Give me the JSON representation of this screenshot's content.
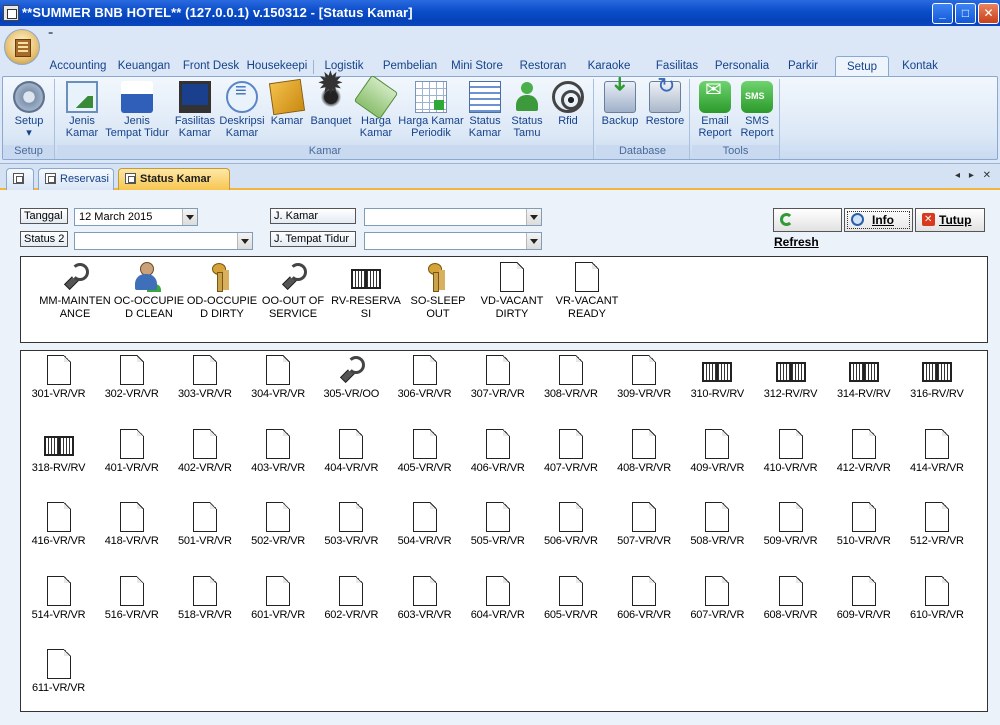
{
  "window": {
    "title": "**SUMMER BNB HOTEL** (127.0.0.1) v.150312 - [Status Kamar]",
    "controls": {
      "minimize": "_",
      "maximize": "□",
      "close": "✕"
    }
  },
  "qat": {
    "dropdown": "⁼"
  },
  "ribbon": {
    "tabs": [
      "Accounting",
      "Keuangan",
      "Front Desk",
      "Housekeepi",
      "Logistik",
      "Pembelian",
      "Mini Store",
      "Restoran",
      "Karaoke",
      "Fasilitas",
      "Personalia",
      "Parkir",
      "Setup",
      "Kontak"
    ],
    "active_tab": "Setup",
    "groups": {
      "setup": {
        "label": "Setup",
        "buttons": {
          "setup": "Setup",
          "setup_arrow": "▾"
        }
      },
      "kamar": {
        "label": "Kamar",
        "buttons": {
          "jenis_kamar": [
            "Jenis",
            "Kamar"
          ],
          "jenis_tempat_tidur": [
            "Jenis",
            "Tempat Tidur"
          ],
          "fasilitas_kamar": [
            "Fasilitas",
            "Kamar"
          ],
          "deskripsi_kamar": [
            "Deskripsi",
            "Kamar"
          ],
          "kamar": [
            "Kamar",
            ""
          ],
          "banquet": [
            "Banquet",
            ""
          ],
          "harga_kamar": [
            "Harga",
            "Kamar"
          ],
          "harga_kamar_periodik": [
            "Harga Kamar",
            "Periodik"
          ],
          "status_kamar": [
            "Status",
            "Kamar"
          ],
          "status_tamu": [
            "Status",
            "Tamu"
          ],
          "rfid": [
            "Rfid",
            ""
          ]
        }
      },
      "database": {
        "label": "Database",
        "buttons": {
          "backup": "Backup",
          "restore": "Restore"
        }
      },
      "tools": {
        "label": "Tools",
        "buttons": {
          "email_report": [
            "Email",
            "Report"
          ],
          "sms_report": [
            "SMS",
            "Report"
          ]
        }
      }
    }
  },
  "doc_tabs": {
    "items": [
      "",
      "Reservasi",
      "Status Kamar"
    ],
    "active": "Status Kamar",
    "nav": "◂ ▸ ✕"
  },
  "filters": {
    "tanggal_label": "Tanggal",
    "tanggal_value": "12   March    2015",
    "status2_label": "Status 2",
    "status2_value": "",
    "jkamar_label": "J. Kamar",
    "jkamar_value": "",
    "jtempat_label": "J. Tempat Tidur",
    "jtempat_value": ""
  },
  "actions": {
    "refresh": "Refresh",
    "info": "Info",
    "tutup": "Tutup"
  },
  "legend": [
    {
      "icon": "wrench-icon",
      "line1": "MM-MAINTEN",
      "line2": "ANCE"
    },
    {
      "icon": "person-icon",
      "line1": "OC-OCCUPIE",
      "line2": "D CLEAN"
    },
    {
      "icon": "keys-icon",
      "line1": "OD-OCCUPIE",
      "line2": "D DIRTY"
    },
    {
      "icon": "wrench-icon",
      "line1": "OO-OUT OF",
      "line2": "SERVICE"
    },
    {
      "icon": "book-icon",
      "line1": "RV-RESERVA",
      "line2": "SI"
    },
    {
      "icon": "keys-icon",
      "line1": "SO-SLEEP",
      "line2": "OUT"
    },
    {
      "icon": "document-icon",
      "line1": "VD-VACANT",
      "line2": "DIRTY"
    },
    {
      "icon": "document-icon",
      "line1": "VR-VACANT",
      "line2": "READY"
    }
  ],
  "rooms": [
    {
      "label": "301-VR/VR",
      "icon": "document-icon"
    },
    {
      "label": "302-VR/VR",
      "icon": "document-icon"
    },
    {
      "label": "303-VR/VR",
      "icon": "document-icon"
    },
    {
      "label": "304-VR/VR",
      "icon": "document-icon"
    },
    {
      "label": "305-VR/OO",
      "icon": "wrench-icon"
    },
    {
      "label": "306-VR/VR",
      "icon": "document-icon"
    },
    {
      "label": "307-VR/VR",
      "icon": "document-icon"
    },
    {
      "label": "308-VR/VR",
      "icon": "document-icon"
    },
    {
      "label": "309-VR/VR",
      "icon": "document-icon"
    },
    {
      "label": "310-RV/RV",
      "icon": "book-icon"
    },
    {
      "label": "312-RV/RV",
      "icon": "book-icon"
    },
    {
      "label": "314-RV/RV",
      "icon": "book-icon"
    },
    {
      "label": "316-RV/RV",
      "icon": "book-icon"
    },
    {
      "label": "318-RV/RV",
      "icon": "book-icon"
    },
    {
      "label": "401-VR/VR",
      "icon": "document-icon"
    },
    {
      "label": "402-VR/VR",
      "icon": "document-icon"
    },
    {
      "label": "403-VR/VR",
      "icon": "document-icon"
    },
    {
      "label": "404-VR/VR",
      "icon": "document-icon"
    },
    {
      "label": "405-VR/VR",
      "icon": "document-icon"
    },
    {
      "label": "406-VR/VR",
      "icon": "document-icon"
    },
    {
      "label": "407-VR/VR",
      "icon": "document-icon"
    },
    {
      "label": "408-VR/VR",
      "icon": "document-icon"
    },
    {
      "label": "409-VR/VR",
      "icon": "document-icon"
    },
    {
      "label": "410-VR/VR",
      "icon": "document-icon"
    },
    {
      "label": "412-VR/VR",
      "icon": "document-icon"
    },
    {
      "label": "414-VR/VR",
      "icon": "document-icon"
    },
    {
      "label": "416-VR/VR",
      "icon": "document-icon"
    },
    {
      "label": "418-VR/VR",
      "icon": "document-icon"
    },
    {
      "label": "501-VR/VR",
      "icon": "document-icon"
    },
    {
      "label": "502-VR/VR",
      "icon": "document-icon"
    },
    {
      "label": "503-VR/VR",
      "icon": "document-icon"
    },
    {
      "label": "504-VR/VR",
      "icon": "document-icon"
    },
    {
      "label": "505-VR/VR",
      "icon": "document-icon"
    },
    {
      "label": "506-VR/VR",
      "icon": "document-icon"
    },
    {
      "label": "507-VR/VR",
      "icon": "document-icon"
    },
    {
      "label": "508-VR/VR",
      "icon": "document-icon"
    },
    {
      "label": "509-VR/VR",
      "icon": "document-icon"
    },
    {
      "label": "510-VR/VR",
      "icon": "document-icon"
    },
    {
      "label": "512-VR/VR",
      "icon": "document-icon"
    },
    {
      "label": "514-VR/VR",
      "icon": "document-icon"
    },
    {
      "label": "516-VR/VR",
      "icon": "document-icon"
    },
    {
      "label": "518-VR/VR",
      "icon": "document-icon"
    },
    {
      "label": "601-VR/VR",
      "icon": "document-icon"
    },
    {
      "label": "602-VR/VR",
      "icon": "document-icon"
    },
    {
      "label": "603-VR/VR",
      "icon": "document-icon"
    },
    {
      "label": "604-VR/VR",
      "icon": "document-icon"
    },
    {
      "label": "605-VR/VR",
      "icon": "document-icon"
    },
    {
      "label": "606-VR/VR",
      "icon": "document-icon"
    },
    {
      "label": "607-VR/VR",
      "icon": "document-icon"
    },
    {
      "label": "608-VR/VR",
      "icon": "document-icon"
    },
    {
      "label": "609-VR/VR",
      "icon": "document-icon"
    },
    {
      "label": "610-VR/VR",
      "icon": "document-icon"
    },
    {
      "label": "611-VR/VR",
      "icon": "document-icon"
    }
  ],
  "colors": {
    "titlebar": "#0a4cc8",
    "active_doc_tab": "#f7c650",
    "ribbon_text": "#15428b"
  }
}
